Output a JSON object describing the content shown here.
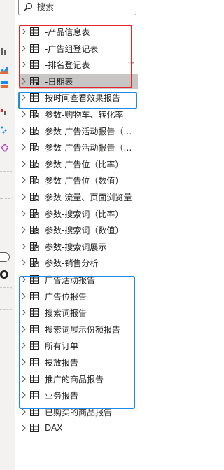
{
  "search": {
    "placeholder": "搜索",
    "value": "",
    "icon": "search-icon"
  },
  "fields": [
    {
      "label": "-产品信息表",
      "icon": "table-icon"
    },
    {
      "label": "-广告组登记表",
      "icon": "table-icon"
    },
    {
      "label": "-排名登记表",
      "icon": "table-icon",
      "more": "···"
    },
    {
      "label": "-日期表",
      "icon": "calendar-table-icon",
      "selected": true
    },
    {
      "label": "按时间查看效果报告",
      "icon": "table-icon"
    },
    {
      "label": "参数-购物车、转化率",
      "icon": "parameter-table-icon"
    },
    {
      "label": "参数-广告活动报告（比...",
      "icon": "parameter-table-icon"
    },
    {
      "label": "参数-广告活动报告（数...",
      "icon": "parameter-table-icon"
    },
    {
      "label": "参数-广告位（比率）",
      "icon": "parameter-table-icon"
    },
    {
      "label": "参数-广告位（数值）",
      "icon": "parameter-table-icon"
    },
    {
      "label": "参数-流量、页面浏览量",
      "icon": "parameter-table-icon"
    },
    {
      "label": "参数-搜索词（比率）",
      "icon": "parameter-table-icon"
    },
    {
      "label": "参数-搜索词（数值）",
      "icon": "parameter-table-icon"
    },
    {
      "label": "参数-搜索词展示",
      "icon": "parameter-table-icon"
    },
    {
      "label": "参数-销售分析",
      "icon": "parameter-table-icon"
    },
    {
      "label": "广告活动报告",
      "icon": "table-icon"
    },
    {
      "label": "广告位报告",
      "icon": "table-icon"
    },
    {
      "label": "搜索词报告",
      "icon": "table-icon"
    },
    {
      "label": "搜索词展示份额报告",
      "icon": "table-icon"
    },
    {
      "label": "所有订单",
      "icon": "table-icon"
    },
    {
      "label": "投放报告",
      "icon": "table-icon"
    },
    {
      "label": "推广的商品报告",
      "icon": "table-icon"
    },
    {
      "label": "业务报告",
      "icon": "table-icon"
    },
    {
      "label": "已购买的商品报告",
      "icon": "table-icon"
    },
    {
      "label": "DAX",
      "icon": "table-icon"
    }
  ],
  "colors": {
    "highlight_red": "#e8242b",
    "highlight_blue": "#1e8ae8",
    "selected_row": "#c8c6c4",
    "text": "#252423"
  }
}
